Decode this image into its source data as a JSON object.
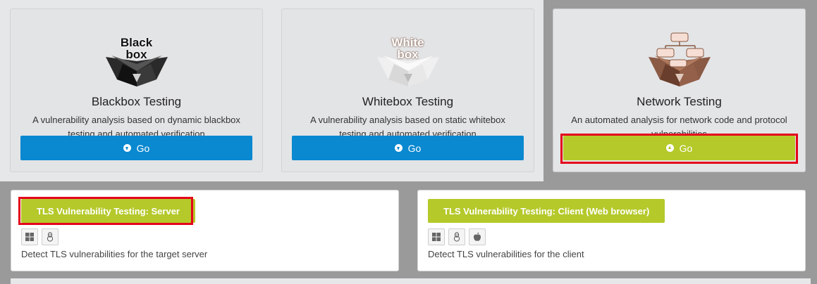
{
  "cards": [
    {
      "logo_line1": "Black",
      "logo_line2": "box",
      "title": "Blackbox Testing",
      "desc_line1": "A vulnerability analysis based on dynamic blackbox",
      "desc_line2": "testing and automated verification",
      "go_label": "Go",
      "go_icon": "download-circle-icon"
    },
    {
      "logo_line1": "White",
      "logo_line2": "box",
      "title": "Whitebox Testing",
      "desc_line1": "A vulnerability analysis based on static whitebox",
      "desc_line2": "testing and automated verification",
      "go_label": "Go",
      "go_icon": "download-circle-icon"
    },
    {
      "title": "Network Testing",
      "desc_line1": "An automated analysis for network code and protocol",
      "desc_line2": "vulnerabilities",
      "go_label": "Go",
      "go_icon": "upload-circle-icon"
    }
  ],
  "tls": [
    {
      "button_label": "TLS Vulnerability Testing: Server",
      "os": [
        "windows-icon",
        "linux-icon"
      ],
      "desc": "Detect TLS vulnerabilities for the target server"
    },
    {
      "button_label": "TLS Vulnerability Testing: Client (Web browser)",
      "os": [
        "windows-icon",
        "linux-icon",
        "apple-icon"
      ],
      "desc": "Detect TLS vulnerabilities for the client"
    }
  ],
  "colors": {
    "blue_button": "#0a88d0",
    "green_button": "#b5c92a",
    "highlight": "#e4001b",
    "panel_gray": "#9a9a9a"
  }
}
